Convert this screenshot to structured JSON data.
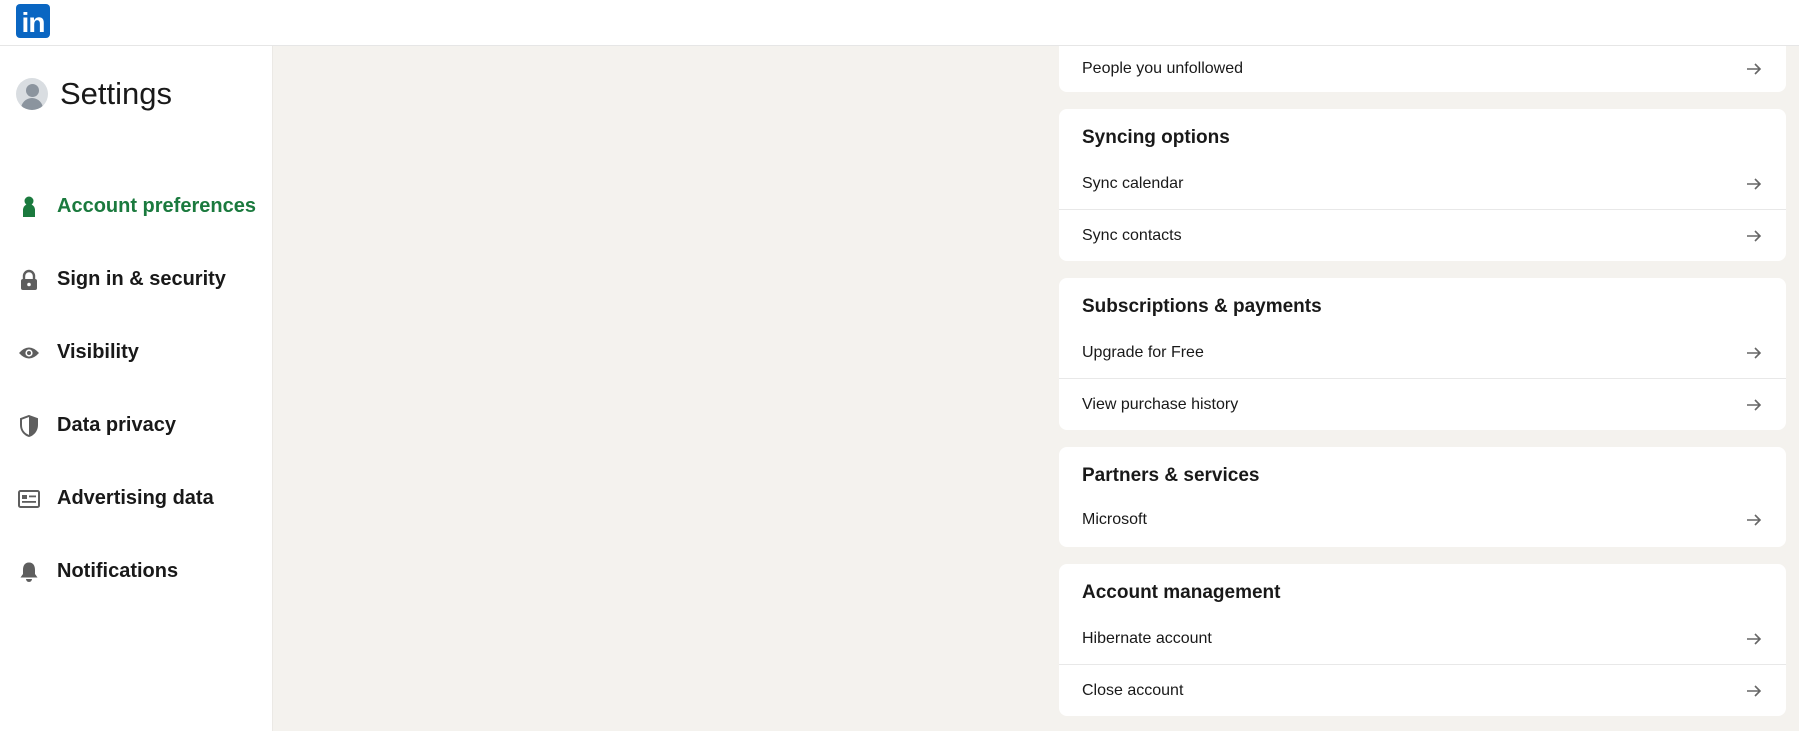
{
  "brand": {
    "logo_text": "in",
    "color": "#0a66c2"
  },
  "sidebar": {
    "title": "Settings",
    "accent_color": "#1b7a3e",
    "items": [
      {
        "label": "Account preferences",
        "icon": "person-icon",
        "active": true
      },
      {
        "label": "Sign in & security",
        "icon": "lock-icon",
        "active": false
      },
      {
        "label": "Visibility",
        "icon": "eye-icon",
        "active": false
      },
      {
        "label": "Data privacy",
        "icon": "shield-icon",
        "active": false
      },
      {
        "label": "Advertising data",
        "icon": "ad-card-icon",
        "active": false
      },
      {
        "label": "Notifications",
        "icon": "bell-icon",
        "active": false
      }
    ]
  },
  "main": {
    "top_row": {
      "label": "People you unfollowed"
    },
    "sections": [
      {
        "title": "Syncing options",
        "items": [
          "Sync calendar",
          "Sync contacts"
        ]
      },
      {
        "title": "Subscriptions & payments",
        "items": [
          "Upgrade for Free",
          "View purchase history"
        ]
      },
      {
        "title": "Partners & services",
        "items": [
          "Microsoft"
        ]
      },
      {
        "title": "Account management",
        "items": [
          "Hibernate account",
          "Close account"
        ]
      }
    ]
  }
}
